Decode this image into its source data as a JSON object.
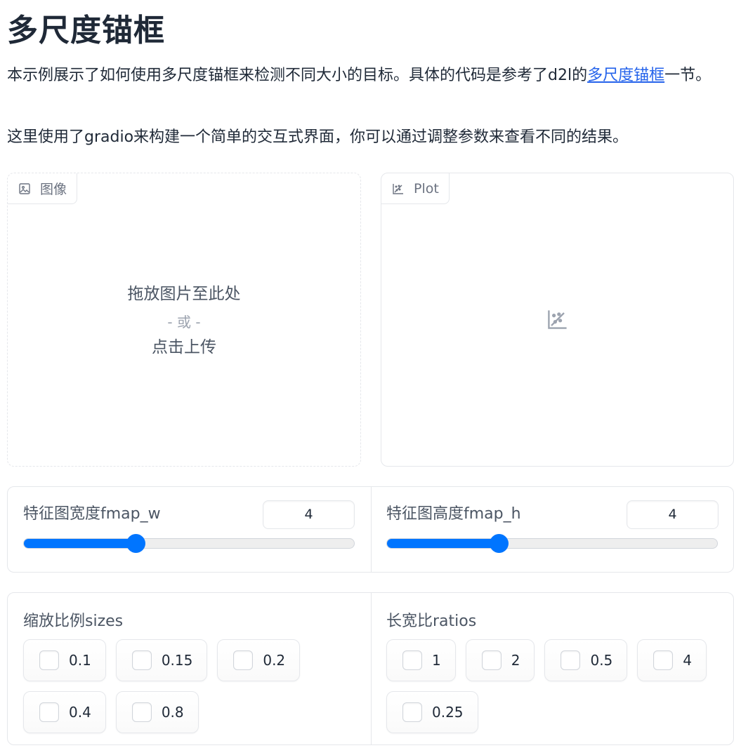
{
  "page": {
    "title": "多尺度锚框",
    "desc1_before": "本示例展示了如何使用多尺度锚框来检测不同大小的目标。具体的代码是参考了d2l的",
    "desc1_link": "多尺度锚框",
    "desc1_after": "一节。",
    "desc2": "这里使用了gradio来构建一个简单的交互式界面，你可以通过调整参数来查看不同的结果。"
  },
  "image_panel": {
    "label": "图像",
    "drop_text": "拖放图片至此处",
    "or_text": "- 或 -",
    "upload_text": "点击上传"
  },
  "plot_panel": {
    "label": "Plot"
  },
  "sliders": [
    {
      "label": "特征图宽度fmap_w",
      "value": "4",
      "fraction": 0.34
    },
    {
      "label": "特征图高度fmap_h",
      "value": "4",
      "fraction": 0.34
    }
  ],
  "checkgroups": [
    {
      "label": "缩放比例sizes",
      "options": [
        "0.1",
        "0.15",
        "0.2",
        "0.4",
        "0.8"
      ]
    },
    {
      "label": "长宽比ratios",
      "options": [
        "1",
        "2",
        "0.5",
        "4",
        "0.25"
      ]
    }
  ],
  "colors": {
    "accent": "#0075ff",
    "link": "#2563eb"
  }
}
